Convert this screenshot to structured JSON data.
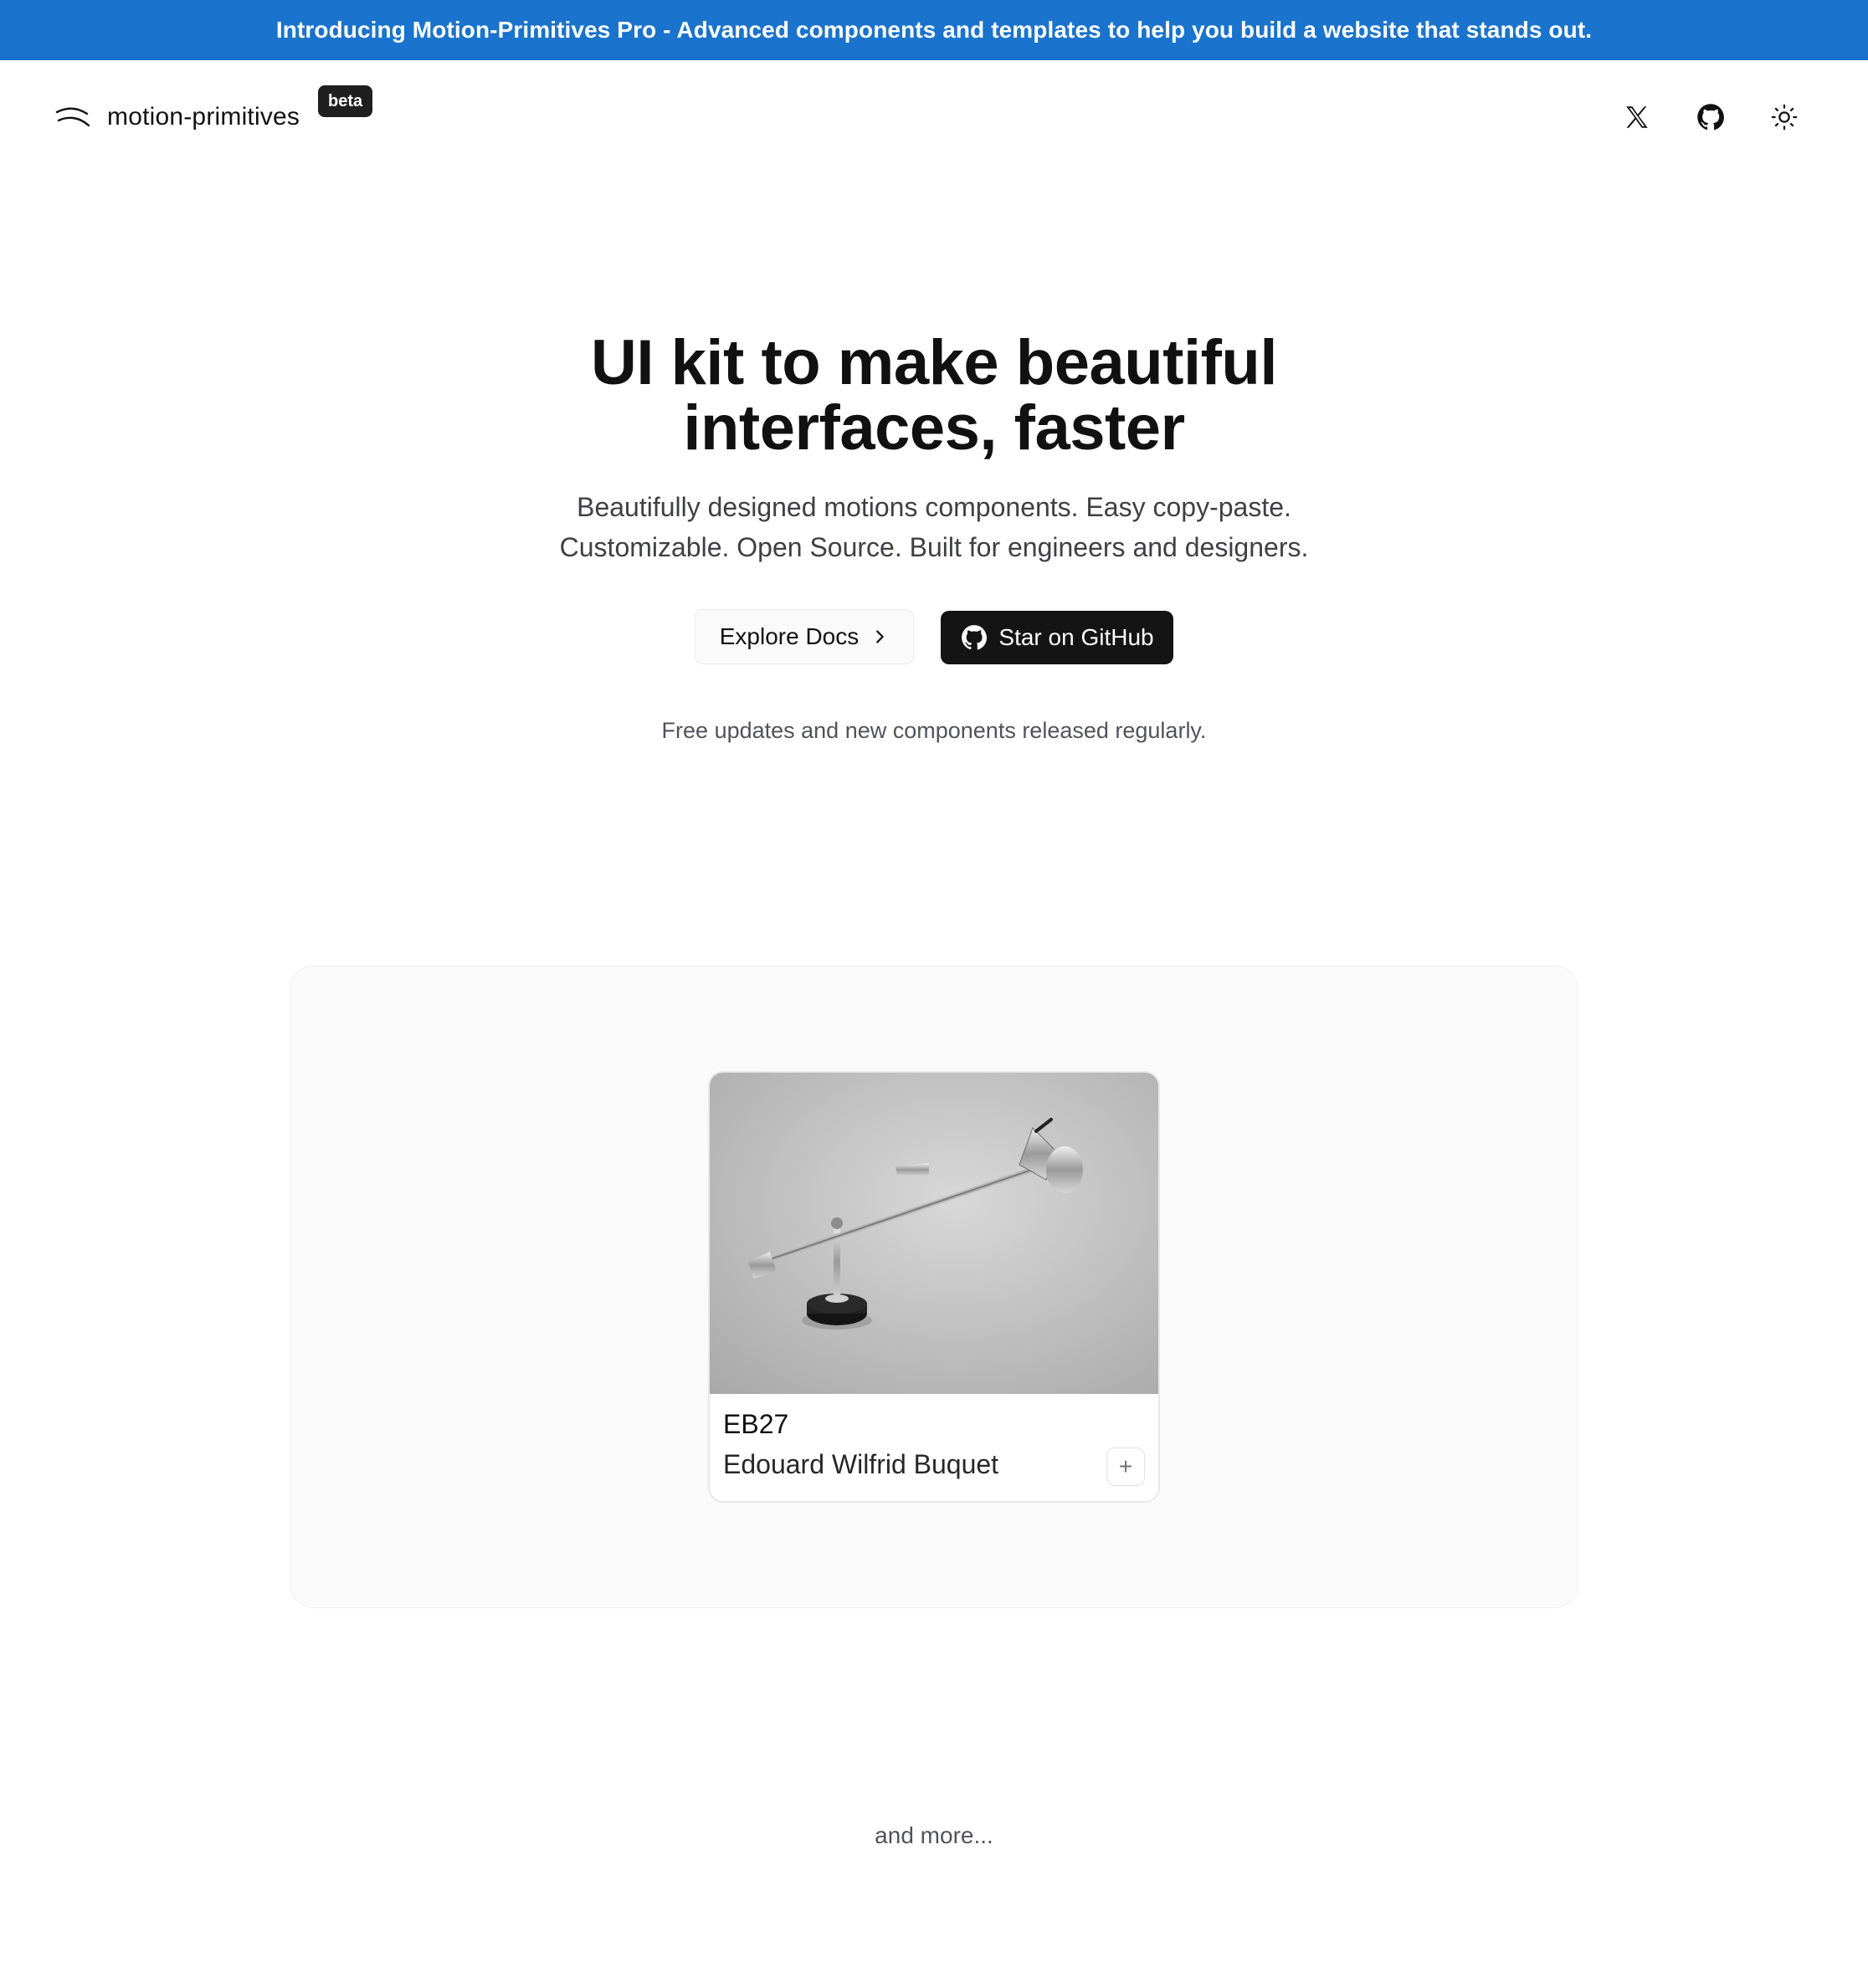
{
  "banner": {
    "text": "Introducing Motion-Primitives Pro - Advanced components and templates to help you build a website that stands out."
  },
  "header": {
    "logo_text": "motion-primitives",
    "badge": "beta",
    "icons": [
      "x-logo-icon",
      "github-icon",
      "sun-icon"
    ]
  },
  "hero": {
    "title_line1": "UI kit to make beautiful",
    "title_line2": "interfaces, faster",
    "subtitle_line1": "Beautifully designed motions components. Easy copy-paste.",
    "subtitle_line2": "Customizable. Open Source. Built for engineers and designers.",
    "docs_button": "Explore Docs",
    "github_button": "Star on GitHub",
    "note": "Free updates and new components released regularly."
  },
  "showcase": {
    "card": {
      "title": "EB27",
      "subtitle": "Edouard Wilfrid Buquet",
      "add_label": "+"
    }
  },
  "footer": {
    "more": "and more..."
  },
  "colors": {
    "banner": "#1a73cc",
    "primary_button": "#141414",
    "text": "#111111",
    "muted": "#52525b"
  }
}
